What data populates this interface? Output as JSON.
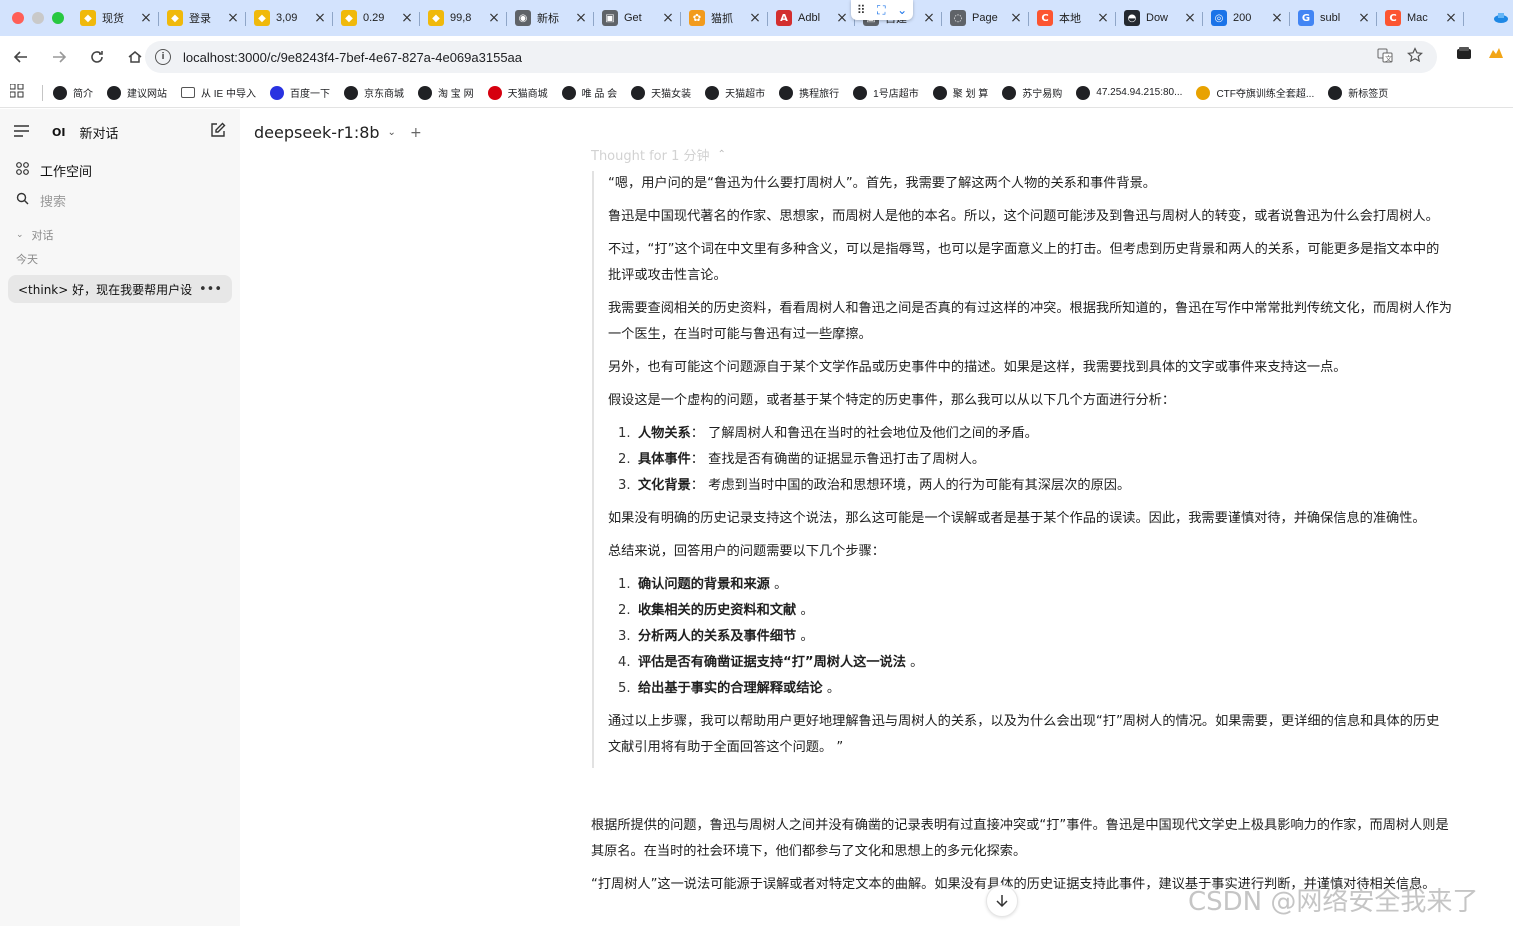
{
  "colors": {
    "tabstrip_bg": "#d3e3fd",
    "sidebar_bg": "#f7f7f7",
    "accent": "#1a73e8"
  },
  "window": {
    "traffic_lights": [
      "#ff5f57",
      "#ffbd2e",
      "#28c840"
    ]
  },
  "tabs": [
    {
      "title": "现货",
      "icon": "binance-icon",
      "color": "#f0b90b",
      "glyph": "◆"
    },
    {
      "title": "登录",
      "icon": "binance-icon",
      "color": "#f0b90b",
      "glyph": "◆"
    },
    {
      "title": "3,09",
      "icon": "binance-icon",
      "color": "#f0b90b",
      "glyph": "◆"
    },
    {
      "title": "0.29",
      "icon": "binance-icon",
      "color": "#f0b90b",
      "glyph": "◆"
    },
    {
      "title": "99,8",
      "icon": "binance-icon",
      "color": "#f0b90b",
      "glyph": "◆"
    },
    {
      "title": "新标",
      "icon": "chrome-icon",
      "color": "#5f6368",
      "glyph": "◉"
    },
    {
      "title": "Get",
      "icon": "page-icon",
      "color": "#5f6368",
      "glyph": "▣"
    },
    {
      "title": "猫抓",
      "icon": "cat-icon",
      "color": "#f29b1d",
      "glyph": "✿"
    },
    {
      "title": "Adbl",
      "icon": "adblock-icon",
      "color": "#d32f2f",
      "glyph": "A"
    },
    {
      "title": "自建",
      "icon": "page-icon",
      "color": "#5f6368",
      "glyph": "▣"
    },
    {
      "title": "Page",
      "icon": "chat-icon",
      "color": "#5f6368",
      "glyph": "◌"
    },
    {
      "title": "本地",
      "icon": "csdn-icon",
      "color": "#fc5531",
      "glyph": "C"
    },
    {
      "title": "Dow",
      "icon": "github-icon",
      "color": "#24292f",
      "glyph": "◓"
    },
    {
      "title": "200",
      "icon": "globe-icon",
      "color": "#1a73e8",
      "glyph": "◎"
    },
    {
      "title": "subl",
      "icon": "google-icon",
      "color": "#4285f4",
      "glyph": "G"
    },
    {
      "title": "Mac",
      "icon": "csdn-icon",
      "color": "#fc5531",
      "glyph": "C"
    }
  ],
  "toolbar": {
    "url": "localhost:3000/c/9e8243f4-7bef-4e67-827a-4e069a3155aa"
  },
  "bookmarks": [
    {
      "label": "简介",
      "color": "#202124"
    },
    {
      "label": "建议网站",
      "color": "#202124"
    },
    {
      "label": "从 IE 中导入",
      "color": "#5f6368",
      "folder": true
    },
    {
      "label": "百度一下",
      "color": "#2932e1"
    },
    {
      "label": "京东商城",
      "color": "#202124"
    },
    {
      "label": "淘 宝 网",
      "color": "#202124"
    },
    {
      "label": "天猫商城",
      "color": "#d6000f"
    },
    {
      "label": "唯 品 会",
      "color": "#202124"
    },
    {
      "label": "天猫女装",
      "color": "#202124"
    },
    {
      "label": "天猫超市",
      "color": "#202124"
    },
    {
      "label": "携程旅行",
      "color": "#202124"
    },
    {
      "label": "1号店超市",
      "color": "#202124"
    },
    {
      "label": "聚 划 算",
      "color": "#202124"
    },
    {
      "label": "苏宁易购",
      "color": "#202124"
    },
    {
      "label": "47.254.94.215:80...",
      "color": "#202124"
    },
    {
      "label": "CTF夺旗训练全套超...",
      "color": "#e8a200"
    },
    {
      "label": "新标签页",
      "color": "#202124"
    }
  ],
  "sidebar": {
    "logo": "OI",
    "new_chat": "新对话",
    "workspace": "工作空间",
    "search_placeholder": "搜索",
    "section_chats": "对话",
    "section_today": "今天",
    "chat_title": "<think> 好，现在我要帮用户设"
  },
  "main": {
    "model_name": "deepseek-r1:8b",
    "plus": "+",
    "thought_label": "Thought for 1 分钟",
    "reasoning": [
      {
        "type": "p",
        "text": "“嗯，用户问的是“鲁迅为什么要打周树人”。首先，我需要了解这两个人物的关系和事件背景。"
      },
      {
        "type": "p",
        "text": "鲁迅是中国现代著名的作家、思想家，而周树人是他的本名。所以，这个问题可能涉及到鲁迅与周树人的转变，或者说鲁迅为什么会打周树人。"
      },
      {
        "type": "p",
        "text": "不过，“打”这个词在中文里有多种含义，可以是指辱骂，也可以是字面意义上的打击。但考虑到历史背景和两人的关系，可能更多是指文本中的批评或攻击性言论。"
      },
      {
        "type": "p",
        "text": "我需要查阅相关的历史资料，看看周树人和鲁迅之间是否真的有过这样的冲突。根据我所知道的，鲁迅在写作中常常批判传统文化，而周树人作为一个医生，在当时可能与鲁迅有过一些摩擦。"
      },
      {
        "type": "p",
        "text": "另外，也有可能这个问题源自于某个文学作品或历史事件中的描述。如果是这样，我需要找到具体的文字或事件来支持这一点。"
      },
      {
        "type": "p",
        "text": "假设这是一个虚构的问题，或者基于某个特定的历史事件，那么我可以从以下几个方面进行分析："
      },
      {
        "type": "ol",
        "items": [
          {
            "num": "1.",
            "bold": "人物关系",
            "rest": "： 了解周树人和鲁迅在当时的社会地位及他们之间的矛盾。"
          },
          {
            "num": "2.",
            "bold": "具体事件",
            "rest": "： 查找是否有确凿的证据显示鲁迅打击了周树人。"
          },
          {
            "num": "3.",
            "bold": "文化背景",
            "rest": "： 考虑到当时中国的政治和思想环境，两人的行为可能有其深层次的原因。"
          }
        ]
      },
      {
        "type": "p",
        "text": "如果没有明确的历史记录支持这个说法，那么这可能是一个误解或者是基于某个作品的误读。因此，我需要谨慎对待，并确保信息的准确性。"
      },
      {
        "type": "p",
        "text": "总结来说，回答用户的问题需要以下几个步骤："
      },
      {
        "type": "ol",
        "items": [
          {
            "num": "1.",
            "bold": "确认问题的背景和来源",
            "rest": " 。"
          },
          {
            "num": "2.",
            "bold": "收集相关的历史资料和文献",
            "rest": " 。"
          },
          {
            "num": "3.",
            "bold": "分析两人的关系及事件细节",
            "rest": " 。"
          },
          {
            "num": "4.",
            "bold": "评估是否有确凿证据支持“打”周树人这一说法",
            "rest": " 。"
          },
          {
            "num": "5.",
            "bold": "给出基于事实的合理解释或结论",
            "rest": " 。"
          }
        ]
      },
      {
        "type": "p",
        "text": "通过以上步骤，我可以帮助用户更好地理解鲁迅与周树人的关系，以及为什么会出现“打”周树人的情况。如果需要，更详细的信息和具体的历史文献引用将有助于全面回答这个问题。 ”"
      }
    ],
    "answer": [
      "根据所提供的问题，鲁迅与周树人之间并没有确凿的记录表明有过直接冲突或“打”事件。鲁迅是中国现代文学史上极具影响力的作家，而周树人则是其原名。在当时的社会环境下，他们都参与了文化和思想上的多元化探索。",
      "“打周树人”这一说法可能源于误解或者对特定文本的曲解。如果没有具体的历史证据支持此事件，建议基于事实进行判断，并谨慎对待相关信息。"
    ],
    "watermark": "CSDN @网络安全我来了"
  }
}
